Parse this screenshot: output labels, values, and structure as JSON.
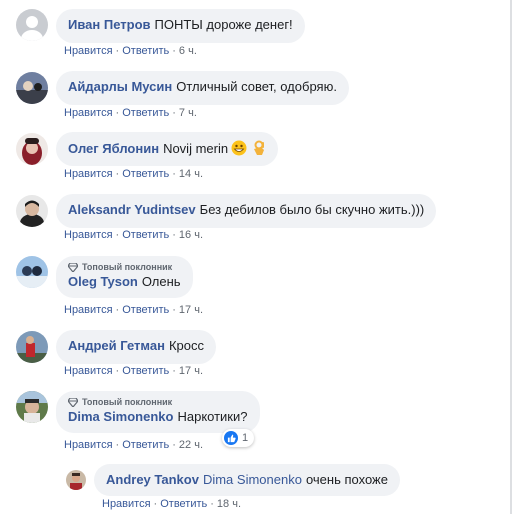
{
  "actions": {
    "like": "Нравится",
    "reply": "Ответить",
    "separator": "·"
  },
  "comments": [
    {
      "author": "Иван Петров",
      "text": "ПОНТЫ дороже денег!",
      "time": "6 ч."
    },
    {
      "author": "Айдарлы Мусин",
      "text": "Отличный совет, одобряю.",
      "time": "7 ч."
    },
    {
      "author": "Олег Яблонин",
      "text": "Novij merin",
      "emoji": [
        "grinning-face-emoji",
        "ok-hand-emoji"
      ],
      "time": "14 ч."
    },
    {
      "author": "Aleksandr Yudintsev",
      "text": "Без дебилов было бы скучно жить.)))",
      "time": "16 ч."
    },
    {
      "badge": "Топовый поклонник",
      "author": "Oleg Tyson",
      "text": "Олень",
      "time": "17 ч."
    },
    {
      "author": "Андрей Гетман",
      "text": "Кросс",
      "time": "17 ч."
    },
    {
      "badge": "Топовый поклонник",
      "author": "Dima Simonenko",
      "text": "Наркотики?",
      "time": "22 ч.",
      "reaction": {
        "icon": "like-icon",
        "count": "1"
      }
    },
    {
      "author": "Andrey Tankov",
      "mention": "Dima Simonenko",
      "text": "очень похоже",
      "time": "18 ч."
    }
  ],
  "colors": {
    "link": "#385898",
    "bubble": "#f0f2f5",
    "meta": "#606770",
    "like_blue": "#1877f2"
  }
}
